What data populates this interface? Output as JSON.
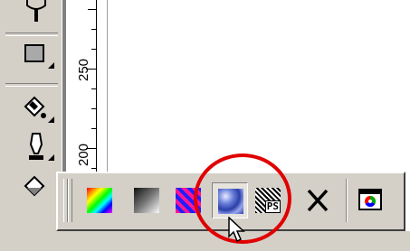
{
  "ruler": {
    "labels": [
      "250",
      "200"
    ]
  },
  "toolbox": {
    "tools": [
      "text-tool-icon",
      "rectangle-tool-icon",
      "fill-tool-icon",
      "outline-tool-icon",
      "interactive-fill-tool-icon"
    ]
  },
  "flyout": {
    "buttons": [
      {
        "name": "fountain-fill-button",
        "icon": "rainbow-gradient-icon"
      },
      {
        "name": "linear-fill-button",
        "icon": "grayscale-gradient-icon"
      },
      {
        "name": "pattern-fill-button",
        "icon": "pattern-icon"
      },
      {
        "name": "texture-fill-button",
        "icon": "texture-icon",
        "state": "pressed"
      },
      {
        "name": "postscript-fill-button",
        "icon": "postscript-icon",
        "label": "PS"
      },
      {
        "name": "no-fill-button",
        "icon": "close-icon"
      },
      {
        "name": "color-docker-button",
        "icon": "color-window-icon"
      }
    ]
  },
  "colors": {
    "highlight": "#e00000",
    "face": "#d4d0c8"
  }
}
